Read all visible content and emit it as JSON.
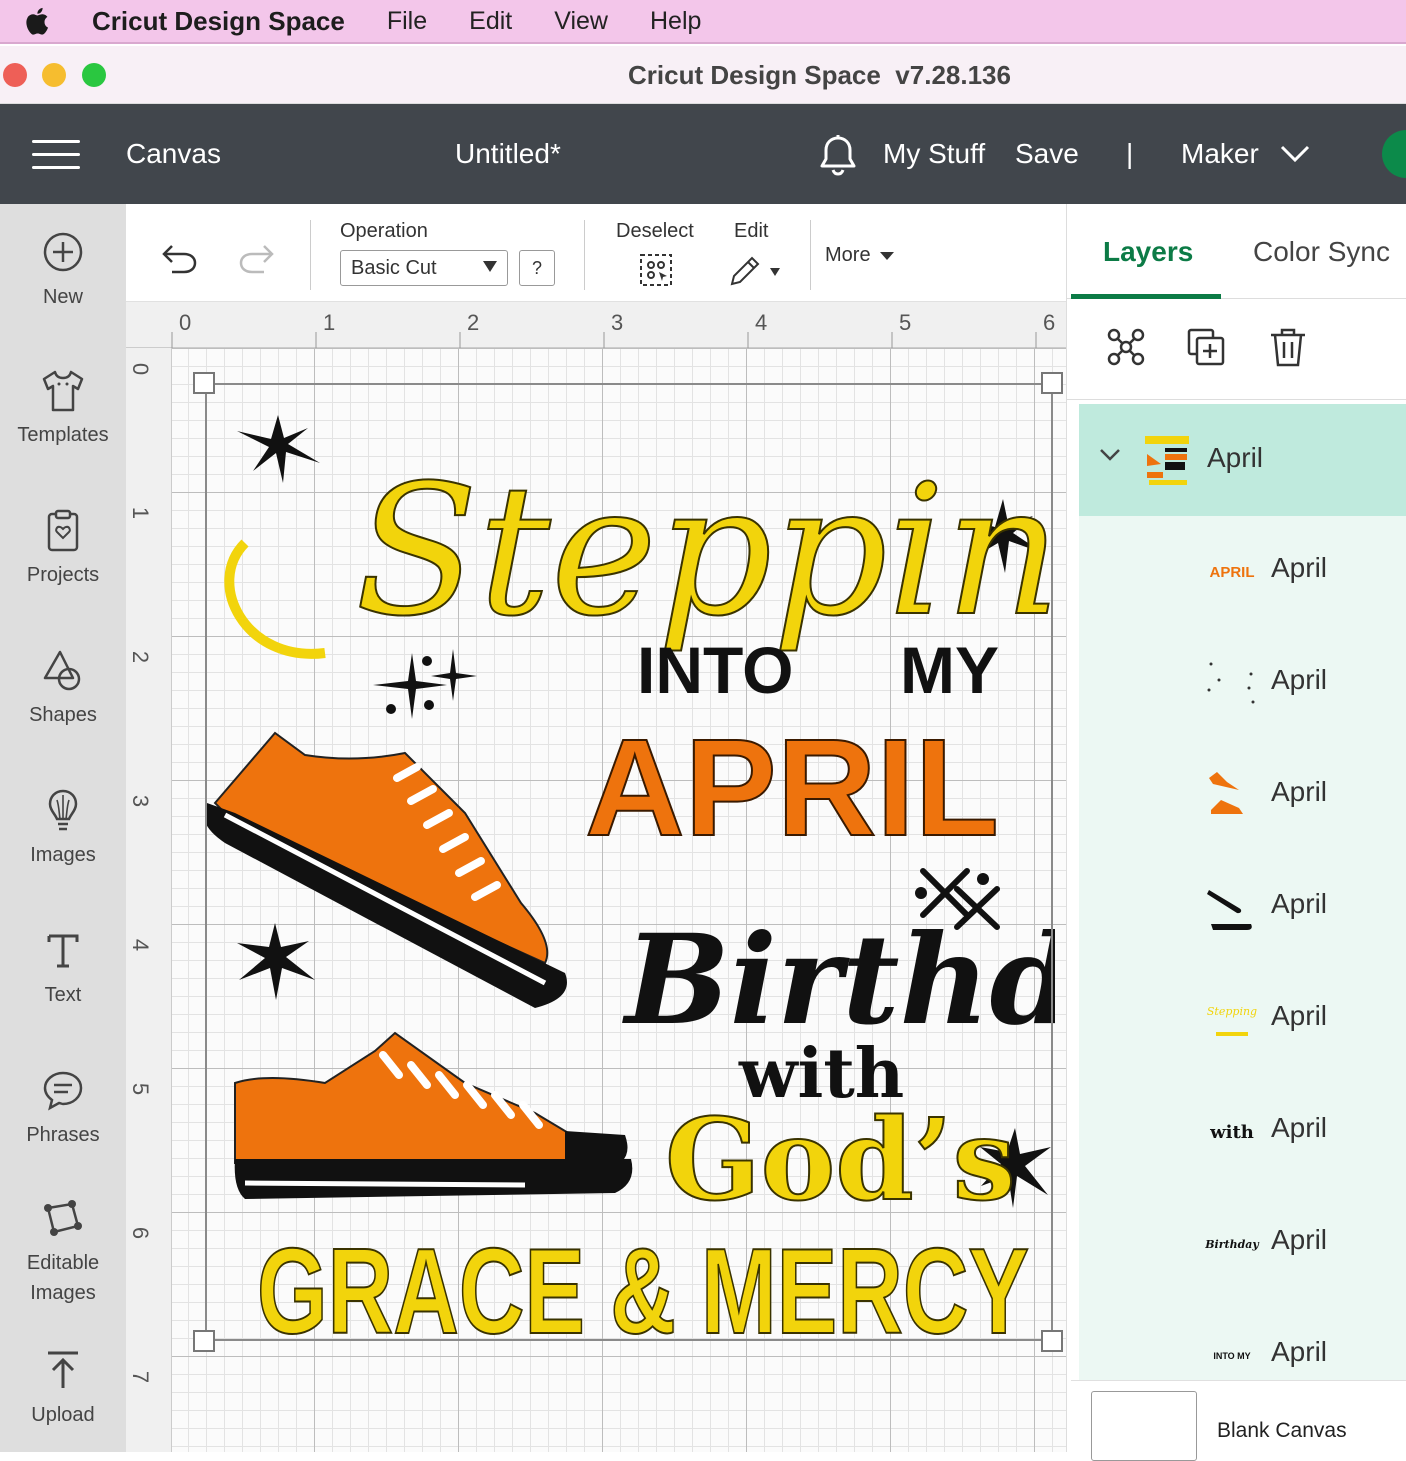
{
  "menubar": {
    "app_name": "Cricut Design Space",
    "menus": [
      "File",
      "Edit",
      "View",
      "Help"
    ]
  },
  "window": {
    "title": "Cricut Design Space  v7.28.136"
  },
  "header": {
    "canvas_label": "Canvas",
    "project_name": "Untitled*",
    "my_stuff": "My Stuff",
    "save": "Save",
    "separator": "|",
    "machine": "Maker"
  },
  "sidebar": {
    "items": [
      {
        "label": "New",
        "icon": "plus-circle-icon"
      },
      {
        "label": "Templates",
        "icon": "shirt-icon"
      },
      {
        "label": "Projects",
        "icon": "clipboard-heart-icon"
      },
      {
        "label": "Shapes",
        "icon": "shapes-icon"
      },
      {
        "label": "Images",
        "icon": "lightbulb-icon"
      },
      {
        "label": "Text",
        "icon": "text-t-icon"
      },
      {
        "label": "Phrases",
        "icon": "speech-bubble-icon"
      },
      {
        "label": "Editable Images",
        "icon": "editable-image-icon"
      },
      {
        "label": "Upload",
        "icon": "upload-icon"
      }
    ]
  },
  "toolbar": {
    "operation_label": "Operation",
    "operation_value": "Basic Cut",
    "help": "?",
    "deselect_label": "Deselect",
    "edit_label": "Edit",
    "more_label": "More"
  },
  "rulers": {
    "top": [
      "0",
      "1",
      "2",
      "3",
      "4",
      "5",
      "6"
    ],
    "left": [
      "0",
      "1",
      "2",
      "3",
      "4",
      "5",
      "6",
      "7"
    ]
  },
  "design": {
    "stepping": "Stepping",
    "into": "INTO",
    "my": "MY",
    "april": "APRIL",
    "birthday": "Birthday",
    "with": "with",
    "gods": "God’s",
    "grace": "GRACE & MERCY"
  },
  "panel": {
    "tabs": [
      "Layers",
      "Color Sync"
    ],
    "group": {
      "name": "April",
      "expanded": true
    },
    "layers": [
      {
        "name": "April",
        "thumb_text": "APRIL",
        "thumb": "april-text"
      },
      {
        "name": "April",
        "thumb_text": "",
        "thumb": "stars-dots"
      },
      {
        "name": "April",
        "thumb_text": "",
        "thumb": "orange-shoes"
      },
      {
        "name": "April",
        "thumb_text": "",
        "thumb": "black-soles"
      },
      {
        "name": "April",
        "thumb_text": "Stepping",
        "thumb": "yellow-text"
      },
      {
        "name": "April",
        "thumb_text": "with",
        "thumb": "with-text"
      },
      {
        "name": "April",
        "thumb_text": "Birthday",
        "thumb": "birthday-text"
      },
      {
        "name": "April",
        "thumb_text": "INTO MY",
        "thumb": "into-my-text"
      }
    ],
    "blank_canvas": "Blank Canvas"
  },
  "colors": {
    "accent_green": "#0c7b46",
    "header_bg": "#41464c",
    "menubar_bg": "#f3c6ea",
    "design_yellow": "#f2d40c",
    "design_orange": "#ee730d"
  }
}
